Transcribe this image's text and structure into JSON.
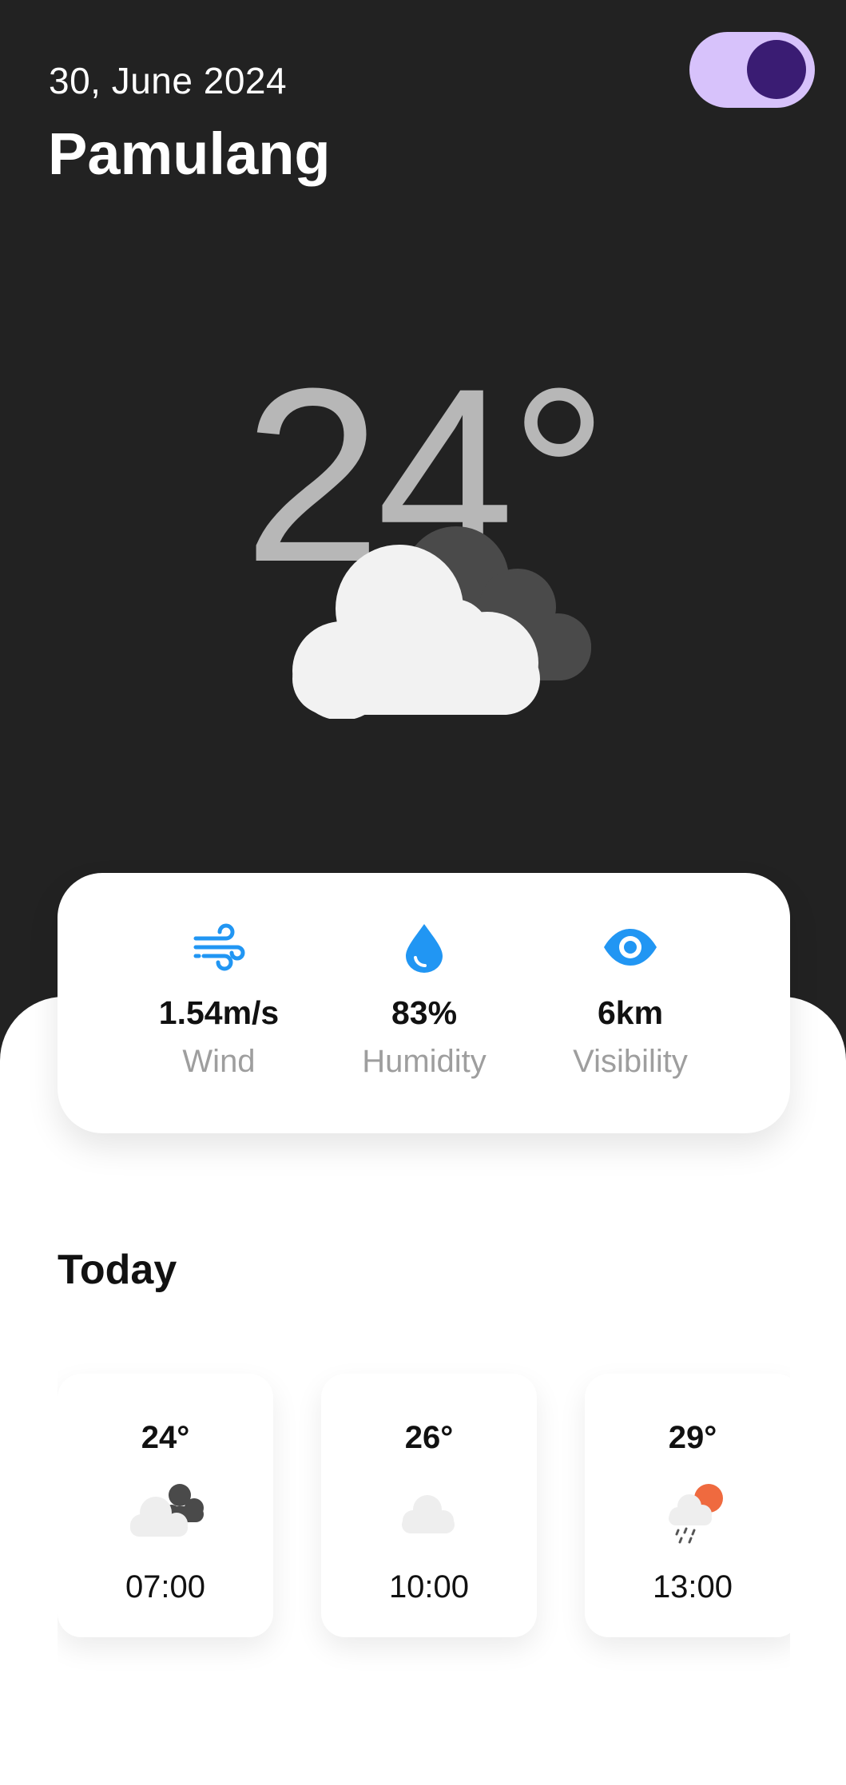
{
  "header": {
    "date": "30, June 2024",
    "city": "Pamulang",
    "dark_mode_toggle": "on"
  },
  "current": {
    "temperature": "24°",
    "condition_icon": "partly-cloudy-dark-icon"
  },
  "stats": [
    {
      "icon": "wind-icon",
      "value": "1.54m/s",
      "label": "Wind"
    },
    {
      "icon": "water-drop-icon",
      "value": "83%",
      "label": "Humidity"
    },
    {
      "icon": "eye-icon",
      "value": "6km",
      "label": "Visibility"
    }
  ],
  "today": {
    "title": "Today",
    "hours": [
      {
        "temp": "24°",
        "icon": "cloudy-dark-icon",
        "time": "07:00"
      },
      {
        "temp": "26°",
        "icon": "cloud-icon",
        "time": "10:00"
      },
      {
        "temp": "29°",
        "icon": "sun-rain-icon",
        "time": "13:00"
      }
    ]
  },
  "colors": {
    "background_dark": "#222222",
    "accent_blue": "#2196f3",
    "toggle_track": "#d7c2fb",
    "toggle_knob": "#3a1c73",
    "sun": "#ef6a3f"
  }
}
